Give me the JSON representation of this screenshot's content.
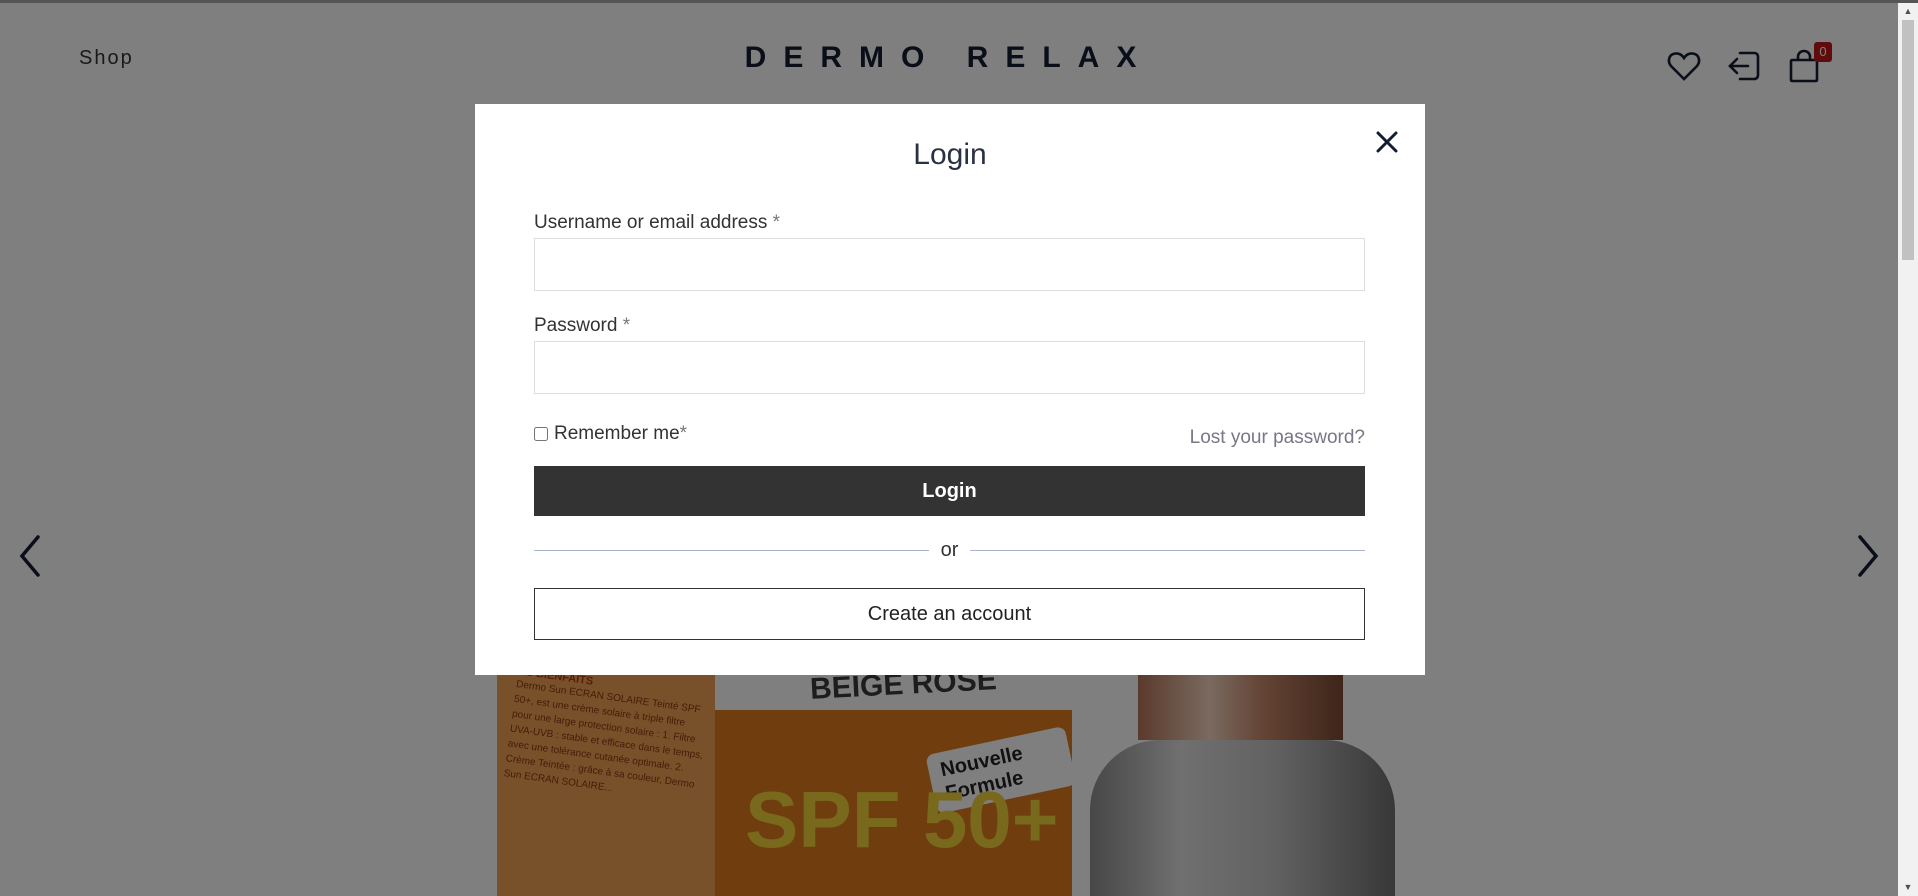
{
  "header": {
    "nav_shop": "Shop",
    "logo": "DERMO RELAX",
    "cart_count": "0",
    "icons": [
      "heart-icon",
      "login-icon",
      "cart-icon"
    ]
  },
  "product_image": {
    "box_shade": "BEIGE ROSE",
    "box_badge": "Nouvelle Formule",
    "box_spf": "SPF 50+",
    "box_side_title": "SES BIENFAITS",
    "box_side_text": "Dermo Sun ECRAN SOLAIRE Teinté SPF 50+, est une crème solaire à triple filtre pour une large protection solaire : 1. Filtre UVA-UVB : stable et efficace dans le temps, avec une tolérance cutanée optimale. 2. Crème Teintée : grâce à sa couleur, Dermo Sun ECRAN SOLAIRE..."
  },
  "modal": {
    "title": "Login",
    "username_label": "Username or email address",
    "password_label": "Password",
    "required_mark": "*",
    "remember_label": "Remember me",
    "lost_password": "Lost your password?",
    "login_button": "Login",
    "or_divider": "or",
    "create_account": "Create an account"
  },
  "colors": {
    "primary_button": "#333333",
    "cart_badge": "#c01818",
    "logo": "#121c33"
  }
}
